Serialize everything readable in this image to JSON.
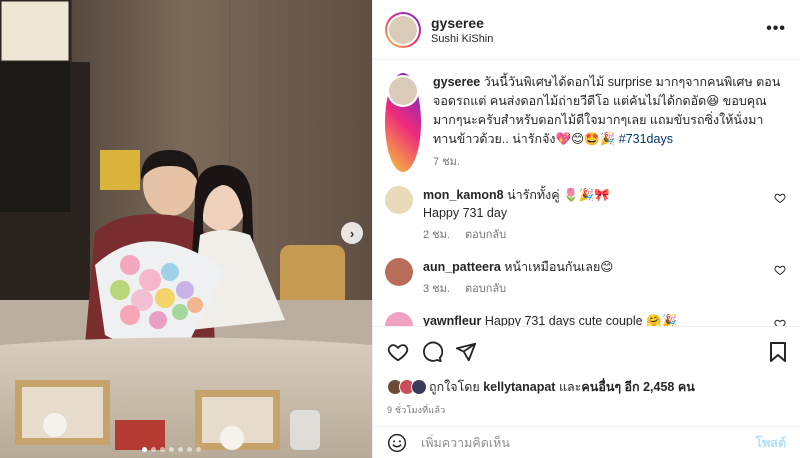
{
  "post": {
    "username": "gyseree",
    "location": "Sushi KiShin",
    "more_label": "•••",
    "caption": "วันนี้วันพิเศษได้ดอกไม้ surprise มากๆจากคนพิเศษ ตอนจอดรถแต่ คนส่งดอกไม้ถ่ายวีดีโอ แต่คันไม่ได้กดอัด😆 ขอบคุณมากๆนะครับสำหรับดอกไม้ดีใจมากๆเลย แถมขับรถซิ่งให้นั่งมาทานข้าวด้วย.. น่ารักจัง💖😊🤩🎉",
    "hashtag": "#731days",
    "caption_time": "7 ชม."
  },
  "comments": [
    {
      "user": "mon_kamon8",
      "text": "น่ารักทั้งคู่ 🌷🎉🎀",
      "reply_text": "Happy 731 day",
      "time": "2 ชม.",
      "reply": "ตอบกลับ",
      "avatar_color": "#e8d9b8"
    },
    {
      "user": "aun_patteera",
      "text": "หน้าเหมือนกันเลย😊",
      "time": "3 ชม.",
      "reply": "ตอบกลับ",
      "avatar_color": "#b86c5a"
    },
    {
      "user": "yawnfleur",
      "text": "Happy 731 days cute couple 🤗🎉",
      "avatar_color": "#f0a0c0"
    }
  ],
  "likes": {
    "text_prefix": "ถูกใจโดย",
    "liker": "kellytanapat",
    "and": "และ",
    "others": "คนอื่นๆ อีก 2,458 คน",
    "liker_colors": [
      "#6b4a3a",
      "#c94f5a",
      "#3a3a5a"
    ]
  },
  "timestamp": "9 ชั่วโมงที่แล้ว",
  "composer": {
    "placeholder": "เพิ่มความคิดเห็น",
    "post_label": "โพสต์"
  },
  "carousel": {
    "next_label": "›",
    "dots_count": 7,
    "active_dot": 0
  }
}
